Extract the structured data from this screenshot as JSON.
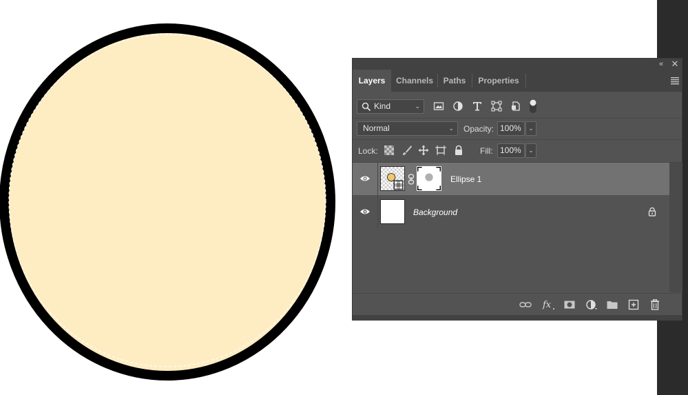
{
  "panel": {
    "collapse_glyph": "«",
    "close_glyph": "✕",
    "tabs": [
      {
        "label": "Layers",
        "active": true
      },
      {
        "label": "Channels",
        "active": false
      },
      {
        "label": "Paths",
        "active": false
      },
      {
        "label": "Properties",
        "active": false
      }
    ],
    "menu_icon": "hamburger-menu-icon"
  },
  "filter": {
    "kind_label": "Kind",
    "icons": [
      "image-filter-icon",
      "adjustment-filter-icon",
      "type-filter-icon",
      "shape-filter-icon",
      "smart-object-filter-icon",
      "filter-toggle-icon"
    ]
  },
  "blend": {
    "mode": "Normal",
    "opacity_label": "Opacity:",
    "opacity_value": "100%"
  },
  "lock": {
    "label": "Lock:",
    "icons": [
      "lock-transparent-pixels-icon",
      "lock-image-pixels-icon",
      "lock-position-icon",
      "lock-artboard-icon",
      "lock-all-icon"
    ],
    "fill_label": "Fill:",
    "fill_value": "100%"
  },
  "layers": [
    {
      "name": "Ellipse 1",
      "selected": true,
      "visible": true,
      "has_mask": true
    },
    {
      "name": "Background",
      "selected": false,
      "visible": true,
      "locked": true
    }
  ],
  "footer_icons": [
    "link-layers-icon",
    "fx-icon",
    "add-mask-icon",
    "adjustment-layer-icon",
    "new-group-icon",
    "new-layer-icon",
    "delete-layer-icon"
  ],
  "colors": {
    "ellipse_fill": "#feecc2",
    "ellipse_stroke": "#000000",
    "panel_bg": "#535353",
    "selected_row": "#727272"
  }
}
